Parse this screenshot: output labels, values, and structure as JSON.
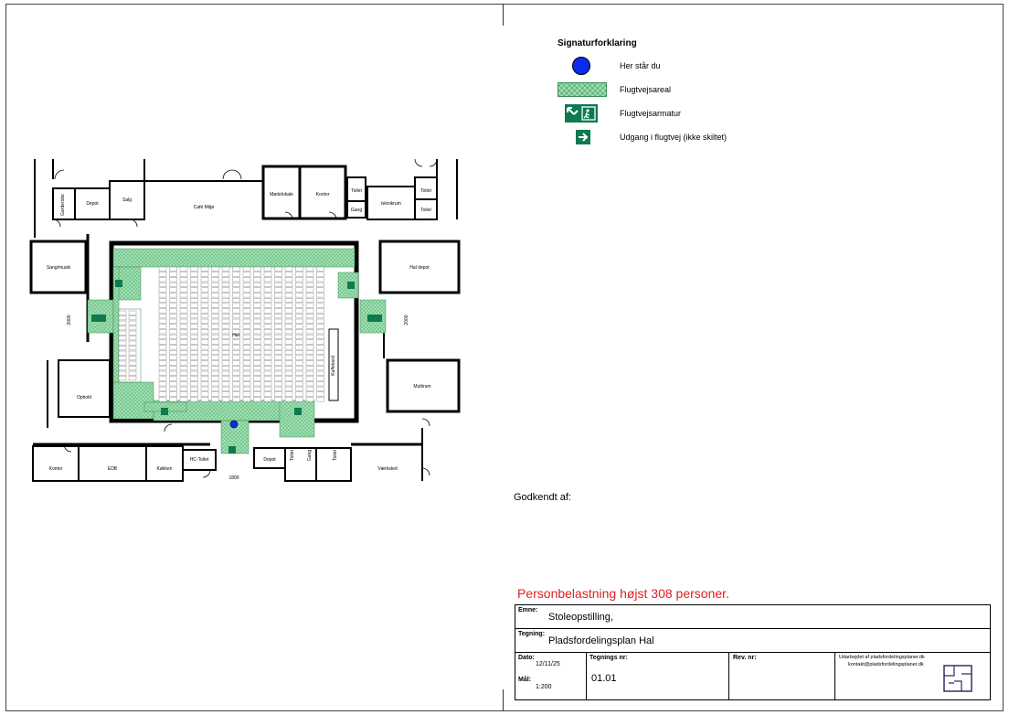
{
  "legend": {
    "title": "Signaturforklaring",
    "items": [
      {
        "icon": "you-are-here-dot",
        "label": "Her står du",
        "color": "#0a2cf0"
      },
      {
        "icon": "escape-route-hatch",
        "label": "Flugtvejsareal",
        "color": "#9ee0b0"
      },
      {
        "icon": "emergency-exit-sign-icon",
        "label": "Flugtvejsarmatur",
        "color": "#0e7a4e"
      },
      {
        "icon": "exit-arrow-icon",
        "label": "Udgang i flugtvej (ikke skiltet)",
        "color": "#0e7a4e"
      }
    ]
  },
  "approval": {
    "label": "Godkendt af:"
  },
  "capacity_notice": "Personbelastning højst 308 personer.",
  "title_block": {
    "emne_label": "Emne:",
    "emne_value": "Stoleopstilling,",
    "tegning_label": "Tegning:",
    "tegning_value": "Pladsfordelingsplan Hal",
    "dato_label": "Dato:",
    "dato_value": "12/11/25",
    "maal_label": "Mål:",
    "maal_value": "1:200",
    "tegnings_nr_label": "Tegnings nr:",
    "tegnings_nr_value": "01.01",
    "rev_label": "Rev. nr:",
    "prepared_by": "Udarbejdet af pladsfordelingsplaner.dk",
    "contact": "kontakt@pladsfordelingsplaner.dk"
  },
  "floorplan": {
    "rooms": [
      "Garderobe",
      "Depot",
      "Salg",
      "Café Miljø",
      "Mødelokale",
      "Kontor",
      "Toilet",
      "Gang",
      "teknikrum",
      "Toilet",
      "Toilet",
      "Sang/musik",
      "Hal depot",
      "Hal",
      "Kaffebord",
      "Ophold",
      "Multirum",
      "Kontor",
      "EDB",
      "Køkken",
      "HC-Toilet",
      "Depot",
      "Toilet",
      "Gang",
      "Toilet",
      "Værksted"
    ],
    "dimensions": [
      "2000",
      "2000",
      "1800"
    ],
    "colors": {
      "wall": "#000000",
      "escape_route": "#9ee0b0",
      "here_marker": "#0a2cf0"
    }
  }
}
